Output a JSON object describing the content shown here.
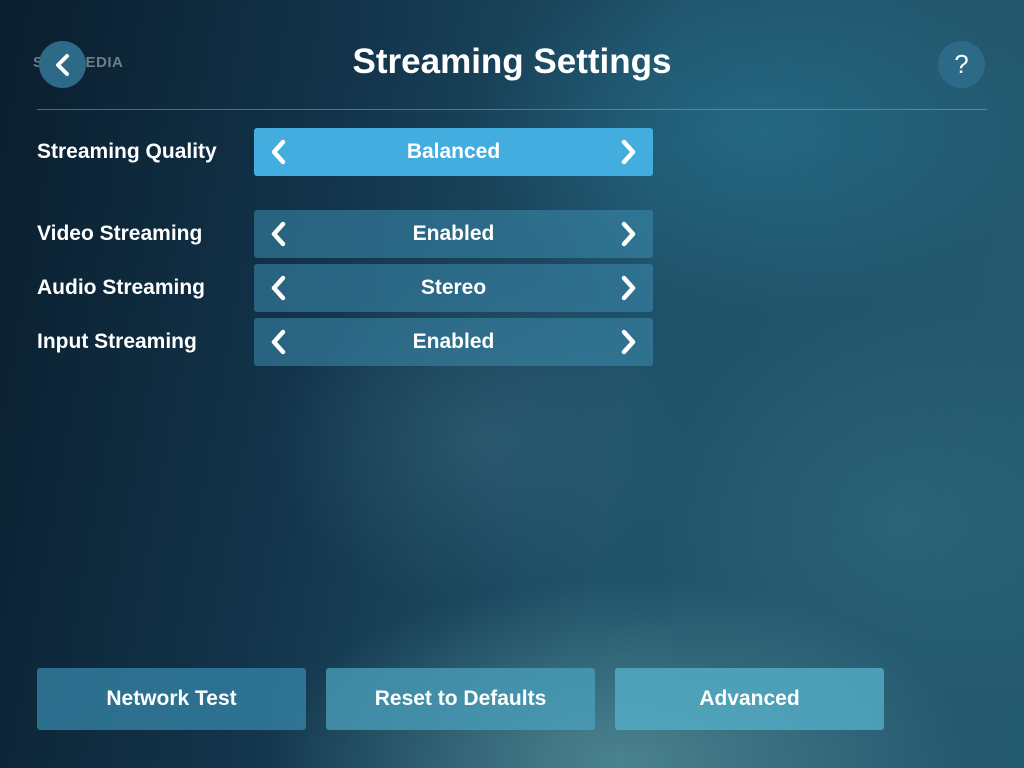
{
  "header": {
    "title": "Streaming Settings",
    "back_icon": "chevron-left-icon",
    "help_label": "?",
    "watermark": "SOFTPEDIA"
  },
  "settings": [
    {
      "label": "Streaming Quality",
      "value": "Balanced",
      "active": true
    },
    {
      "label": "Video Streaming",
      "value": "Enabled",
      "active": false
    },
    {
      "label": "Audio Streaming",
      "value": "Stereo",
      "active": false
    },
    {
      "label": "Input Streaming",
      "value": "Enabled",
      "active": false
    }
  ],
  "footer": {
    "network_test": "Network Test",
    "reset_defaults": "Reset to Defaults",
    "advanced": "Advanced"
  },
  "colors": {
    "accent_active": "#43ade0",
    "round_button": "#2d6a88"
  }
}
